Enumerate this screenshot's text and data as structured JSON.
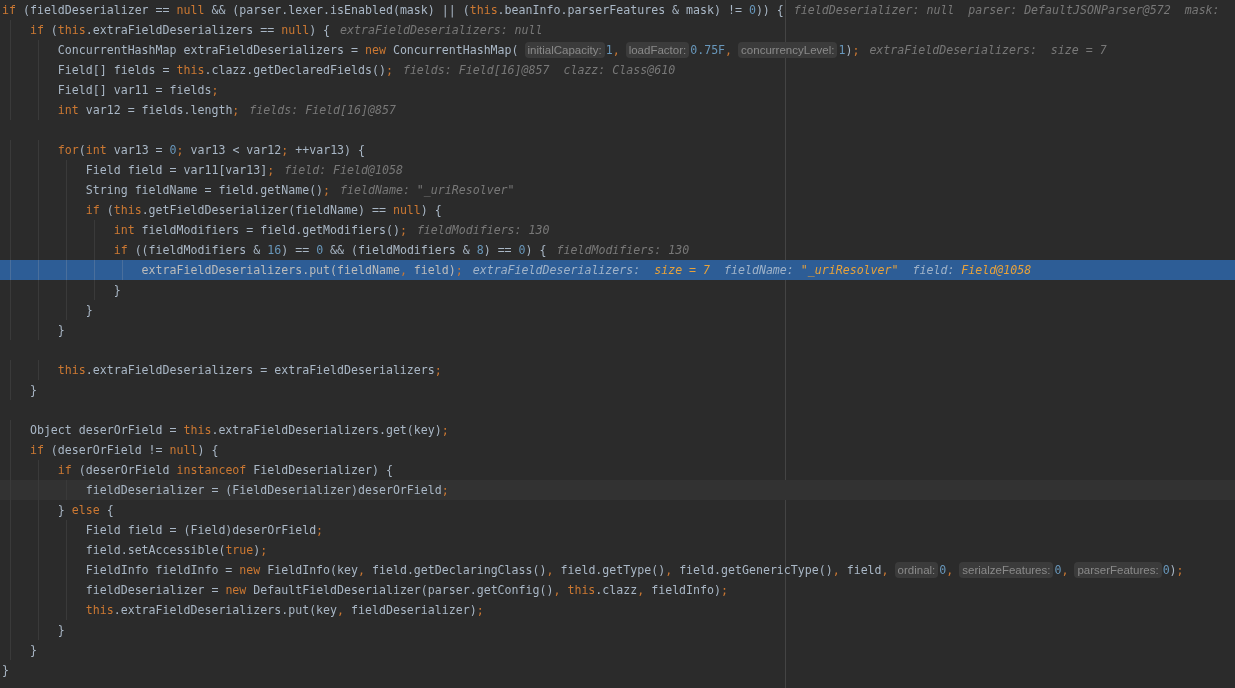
{
  "editor": {
    "lines": [
      {
        "kind": "plain",
        "segments": [
          {
            "kind": "code",
            "parts": [
              {
                "text": "if",
                "kind": "keyword"
              },
              {
                "text": " (fieldDeserializer == ",
                "kind": "plain"
              },
              {
                "text": "null",
                "kind": "keyword"
              },
              {
                "text": " && (parser.lexer.isEnabled(mask) || (",
                "kind": "plain"
              },
              {
                "text": "this",
                "kind": "keyword"
              },
              {
                "text": ".beanInfo.parserFeatures & mask) != ",
                "kind": "plain"
              },
              {
                "text": "0",
                "kind": "number"
              },
              {
                "text": ")) {",
                "kind": "plain"
              }
            ]
          },
          {
            "kind": "debug",
            "parts": [
              {
                "text": "fieldDeserializer: null  parser: DefaultJSONParser@572  mask:",
                "kind": "label"
              }
            ]
          }
        ]
      },
      {
        "kind": "plain",
        "segments": [
          {
            "kind": "code",
            "parts": [
              {
                "text": "    if",
                "kind": "keyword"
              },
              {
                "text": " (",
                "kind": "plain"
              },
              {
                "text": "this",
                "kind": "keyword"
              },
              {
                "text": ".extraFieldDeserializers == ",
                "kind": "plain"
              },
              {
                "text": "null",
                "kind": "keyword"
              },
              {
                "text": ") {",
                "kind": "plain"
              }
            ]
          },
          {
            "kind": "debug",
            "parts": [
              {
                "text": "extraFieldDeserializers: null",
                "kind": "label"
              }
            ]
          }
        ]
      },
      {
        "kind": "plain",
        "segments": [
          {
            "kind": "code",
            "parts": [
              {
                "text": "        ConcurrentHashMap extraFieldDeserializers = ",
                "kind": "plain"
              },
              {
                "text": "new",
                "kind": "keyword"
              },
              {
                "text": " ConcurrentHashMap(",
                "kind": "plain"
              }
            ]
          },
          {
            "kind": "hint",
            "text": "initialCapacity:"
          },
          {
            "kind": "code",
            "parts": [
              {
                "text": "1",
                "kind": "number"
              },
              {
                "text": ",",
                "kind": "keyword"
              }
            ]
          },
          {
            "kind": "hint",
            "text": "loadFactor:"
          },
          {
            "kind": "code",
            "parts": [
              {
                "text": "0.75F",
                "kind": "number"
              },
              {
                "text": ",",
                "kind": "keyword"
              }
            ]
          },
          {
            "kind": "hint",
            "text": "concurrencyLevel:"
          },
          {
            "kind": "code",
            "parts": [
              {
                "text": "1",
                "kind": "number"
              },
              {
                "text": ")",
                "kind": "plain"
              },
              {
                "text": ";",
                "kind": "keyword"
              }
            ]
          },
          {
            "kind": "debug",
            "parts": [
              {
                "text": "extraFieldDeserializers:  size = 7",
                "kind": "label"
              }
            ]
          }
        ]
      },
      {
        "kind": "plain",
        "segments": [
          {
            "kind": "code",
            "parts": [
              {
                "text": "        Field[] fields = ",
                "kind": "plain"
              },
              {
                "text": "this",
                "kind": "keyword"
              },
              {
                "text": ".clazz.getDeclaredFields()",
                "kind": "plain"
              },
              {
                "text": ";",
                "kind": "keyword"
              }
            ]
          },
          {
            "kind": "debug",
            "parts": [
              {
                "text": "fields: Field[16]@857  clazz: Class@610",
                "kind": "label"
              }
            ]
          }
        ]
      },
      {
        "kind": "plain",
        "segments": [
          {
            "kind": "code",
            "parts": [
              {
                "text": "        Field[] var11 = fields",
                "kind": "plain"
              },
              {
                "text": ";",
                "kind": "keyword"
              }
            ]
          }
        ]
      },
      {
        "kind": "plain",
        "segments": [
          {
            "kind": "code",
            "parts": [
              {
                "text": "        int",
                "kind": "keyword"
              },
              {
                "text": " var12 = fields.length",
                "kind": "plain"
              },
              {
                "text": ";",
                "kind": "keyword"
              }
            ]
          },
          {
            "kind": "debug",
            "parts": [
              {
                "text": "fields: Field[16]@857",
                "kind": "label"
              }
            ]
          }
        ]
      },
      {
        "kind": "plain"
      },
      {
        "kind": "plain",
        "segments": [
          {
            "kind": "code",
            "parts": [
              {
                "text": "        for",
                "kind": "keyword"
              },
              {
                "text": "(",
                "kind": "plain"
              },
              {
                "text": "int",
                "kind": "keyword"
              },
              {
                "text": " var13 = ",
                "kind": "plain"
              },
              {
                "text": "0",
                "kind": "number"
              },
              {
                "text": "; ",
                "kind": "keyword"
              },
              {
                "text": "var13 < var12",
                "kind": "plain"
              },
              {
                "text": "; ",
                "kind": "keyword"
              },
              {
                "text": "++var13) {",
                "kind": "plain"
              }
            ]
          }
        ]
      },
      {
        "kind": "plain",
        "segments": [
          {
            "kind": "code",
            "parts": [
              {
                "text": "            Field field = var11[var13]",
                "kind": "plain"
              },
              {
                "text": ";",
                "kind": "keyword"
              }
            ]
          },
          {
            "kind": "debug",
            "parts": [
              {
                "text": "field: Field@1058",
                "kind": "label"
              }
            ]
          }
        ]
      },
      {
        "kind": "plain",
        "segments": [
          {
            "kind": "code",
            "parts": [
              {
                "text": "            String fieldName = field.getName()",
                "kind": "plain"
              },
              {
                "text": ";",
                "kind": "keyword"
              }
            ]
          },
          {
            "kind": "debug",
            "parts": [
              {
                "text": "fieldName: \"_uriResolver\"",
                "kind": "label"
              }
            ]
          }
        ]
      },
      {
        "kind": "plain",
        "segments": [
          {
            "kind": "code",
            "parts": [
              {
                "text": "            if",
                "kind": "keyword"
              },
              {
                "text": " (",
                "kind": "plain"
              },
              {
                "text": "this",
                "kind": "keyword"
              },
              {
                "text": ".getFieldDeserializer(fieldName) == ",
                "kind": "plain"
              },
              {
                "text": "null",
                "kind": "keyword"
              },
              {
                "text": ") {",
                "kind": "plain"
              }
            ]
          }
        ]
      },
      {
        "kind": "plain",
        "segments": [
          {
            "kind": "code",
            "parts": [
              {
                "text": "                int",
                "kind": "keyword"
              },
              {
                "text": " fieldModifiers = field.getModifiers()",
                "kind": "plain"
              },
              {
                "text": ";",
                "kind": "keyword"
              }
            ]
          },
          {
            "kind": "debug",
            "parts": [
              {
                "text": "fieldModifiers: 130",
                "kind": "label"
              }
            ]
          }
        ]
      },
      {
        "kind": "plain",
        "segments": [
          {
            "kind": "code",
            "parts": [
              {
                "text": "                if",
                "kind": "keyword"
              },
              {
                "text": " ((fieldModifiers & ",
                "kind": "plain"
              },
              {
                "text": "16",
                "kind": "number"
              },
              {
                "text": ") == ",
                "kind": "plain"
              },
              {
                "text": "0",
                "kind": "number"
              },
              {
                "text": " && (fieldModifiers & ",
                "kind": "plain"
              },
              {
                "text": "8",
                "kind": "number"
              },
              {
                "text": ") == ",
                "kind": "plain"
              },
              {
                "text": "0",
                "kind": "number"
              },
              {
                "text": ") {",
                "kind": "plain"
              }
            ]
          },
          {
            "kind": "debug",
            "parts": [
              {
                "text": "fieldModifiers: 130",
                "kind": "label"
              }
            ]
          }
        ]
      },
      {
        "kind": "execution",
        "segments": [
          {
            "kind": "code",
            "parts": [
              {
                "text": "                    extraFieldDeserializers.put(fieldName",
                "kind": "plain"
              },
              {
                "text": ", ",
                "kind": "keyword"
              },
              {
                "text": "field)",
                "kind": "plain"
              },
              {
                "text": ";",
                "kind": "keyword"
              }
            ]
          },
          {
            "kind": "debug",
            "parts": [
              {
                "text": "extraFieldDeserializers:  ",
                "kind": "label"
              },
              {
                "text": "size = 7",
                "kind": "value"
              },
              {
                "text": "  fieldName: ",
                "kind": "label"
              },
              {
                "text": "\"_uriResolver\"",
                "kind": "value"
              },
              {
                "text": "  field: ",
                "kind": "label"
              },
              {
                "text": "Field@1058",
                "kind": "value"
              }
            ]
          }
        ]
      },
      {
        "kind": "plain",
        "segments": [
          {
            "kind": "code",
            "parts": [
              {
                "text": "                }",
                "kind": "plain"
              }
            ]
          }
        ]
      },
      {
        "kind": "plain",
        "segments": [
          {
            "kind": "code",
            "parts": [
              {
                "text": "            }",
                "kind": "plain"
              }
            ]
          }
        ]
      },
      {
        "kind": "plain",
        "segments": [
          {
            "kind": "code",
            "parts": [
              {
                "text": "        }",
                "kind": "plain"
              }
            ]
          }
        ]
      },
      {
        "kind": "plain"
      },
      {
        "kind": "plain",
        "segments": [
          {
            "kind": "code",
            "parts": [
              {
                "text": "        this",
                "kind": "keyword"
              },
              {
                "text": ".extraFieldDeserializers = extraFieldDeserializers",
                "kind": "plain"
              },
              {
                "text": ";",
                "kind": "keyword"
              }
            ]
          }
        ]
      },
      {
        "kind": "plain",
        "segments": [
          {
            "kind": "code",
            "parts": [
              {
                "text": "    }",
                "kind": "plain"
              }
            ]
          }
        ]
      },
      {
        "kind": "plain"
      },
      {
        "kind": "plain",
        "segments": [
          {
            "kind": "code",
            "parts": [
              {
                "text": "    Object deserOrField = ",
                "kind": "plain"
              },
              {
                "text": "this",
                "kind": "keyword"
              },
              {
                "text": ".extraFieldDeserializers.get(key)",
                "kind": "plain"
              },
              {
                "text": ";",
                "kind": "keyword"
              }
            ]
          }
        ]
      },
      {
        "kind": "plain",
        "segments": [
          {
            "kind": "code",
            "parts": [
              {
                "text": "    if",
                "kind": "keyword"
              },
              {
                "text": " (deserOrField != ",
                "kind": "plain"
              },
              {
                "text": "null",
                "kind": "keyword"
              },
              {
                "text": ") {",
                "kind": "plain"
              }
            ]
          }
        ]
      },
      {
        "kind": "plain",
        "segments": [
          {
            "kind": "code",
            "parts": [
              {
                "text": "        if",
                "kind": "keyword"
              },
              {
                "text": " (deserOrField ",
                "kind": "plain"
              },
              {
                "text": "instanceof",
                "kind": "keyword"
              },
              {
                "text": " FieldDeserializer) {",
                "kind": "plain"
              }
            ]
          }
        ]
      },
      {
        "kind": "caret",
        "segments": [
          {
            "kind": "code",
            "parts": [
              {
                "text": "            fieldDeserializer = (FieldDeserializer)deserOrField",
                "kind": "plain"
              },
              {
                "text": ";",
                "kind": "keyword"
              }
            ]
          }
        ]
      },
      {
        "kind": "plain",
        "segments": [
          {
            "kind": "code",
            "parts": [
              {
                "text": "        } ",
                "kind": "plain"
              },
              {
                "text": "else",
                "kind": "keyword"
              },
              {
                "text": " {",
                "kind": "plain"
              }
            ]
          }
        ]
      },
      {
        "kind": "plain",
        "segments": [
          {
            "kind": "code",
            "parts": [
              {
                "text": "            Field field = (Field)deserOrField",
                "kind": "plain"
              },
              {
                "text": ";",
                "kind": "keyword"
              }
            ]
          }
        ]
      },
      {
        "kind": "plain",
        "segments": [
          {
            "kind": "code",
            "parts": [
              {
                "text": "            field.setAccessible(",
                "kind": "plain"
              },
              {
                "text": "true",
                "kind": "keyword"
              },
              {
                "text": ")",
                "kind": "plain"
              },
              {
                "text": ";",
                "kind": "keyword"
              }
            ]
          }
        ]
      },
      {
        "kind": "plain",
        "segments": [
          {
            "kind": "code",
            "parts": [
              {
                "text": "            FieldInfo fieldInfo = ",
                "kind": "plain"
              },
              {
                "text": "new",
                "kind": "keyword"
              },
              {
                "text": " FieldInfo(key",
                "kind": "plain"
              },
              {
                "text": ", ",
                "kind": "keyword"
              },
              {
                "text": "field.getDeclaringClass()",
                "kind": "plain"
              },
              {
                "text": ", ",
                "kind": "keyword"
              },
              {
                "text": "field.getType()",
                "kind": "plain"
              },
              {
                "text": ", ",
                "kind": "keyword"
              },
              {
                "text": "field.getGenericType()",
                "kind": "plain"
              },
              {
                "text": ", ",
                "kind": "keyword"
              },
              {
                "text": "field",
                "kind": "plain"
              },
              {
                "text": ",",
                "kind": "keyword"
              }
            ]
          },
          {
            "kind": "hint",
            "text": "ordinal:"
          },
          {
            "kind": "code",
            "parts": [
              {
                "text": "0",
                "kind": "number"
              },
              {
                "text": ",",
                "kind": "keyword"
              }
            ]
          },
          {
            "kind": "hint",
            "text": "serialzeFeatures:"
          },
          {
            "kind": "code",
            "parts": [
              {
                "text": "0",
                "kind": "number"
              },
              {
                "text": ",",
                "kind": "keyword"
              }
            ]
          },
          {
            "kind": "hint",
            "text": "parserFeatures:"
          },
          {
            "kind": "code",
            "parts": [
              {
                "text": "0",
                "kind": "number"
              },
              {
                "text": ")",
                "kind": "plain"
              },
              {
                "text": ";",
                "kind": "keyword"
              }
            ]
          }
        ]
      },
      {
        "kind": "plain",
        "segments": [
          {
            "kind": "code",
            "parts": [
              {
                "text": "            fieldDeserializer = ",
                "kind": "plain"
              },
              {
                "text": "new",
                "kind": "keyword"
              },
              {
                "text": " DefaultFieldDeserializer(parser.getConfig()",
                "kind": "plain"
              },
              {
                "text": ", ",
                "kind": "keyword"
              },
              {
                "text": "this",
                "kind": "keyword"
              },
              {
                "text": ".clazz",
                "kind": "plain"
              },
              {
                "text": ", ",
                "kind": "keyword"
              },
              {
                "text": "fieldInfo)",
                "kind": "plain"
              },
              {
                "text": ";",
                "kind": "keyword"
              }
            ]
          }
        ]
      },
      {
        "kind": "plain",
        "segments": [
          {
            "kind": "code",
            "parts": [
              {
                "text": "            this",
                "kind": "keyword"
              },
              {
                "text": ".extraFieldDeserializers.put(key",
                "kind": "plain"
              },
              {
                "text": ", ",
                "kind": "keyword"
              },
              {
                "text": "fieldDeserializer)",
                "kind": "plain"
              },
              {
                "text": ";",
                "kind": "keyword"
              }
            ]
          }
        ]
      },
      {
        "kind": "plain",
        "segments": [
          {
            "kind": "code",
            "parts": [
              {
                "text": "        }",
                "kind": "plain"
              }
            ]
          }
        ]
      },
      {
        "kind": "plain",
        "segments": [
          {
            "kind": "code",
            "parts": [
              {
                "text": "    }",
                "kind": "plain"
              }
            ]
          }
        ]
      },
      {
        "kind": "plain",
        "segments": [
          {
            "kind": "code",
            "parts": [
              {
                "text": "}",
                "kind": "plain"
              }
            ]
          }
        ]
      }
    ]
  }
}
